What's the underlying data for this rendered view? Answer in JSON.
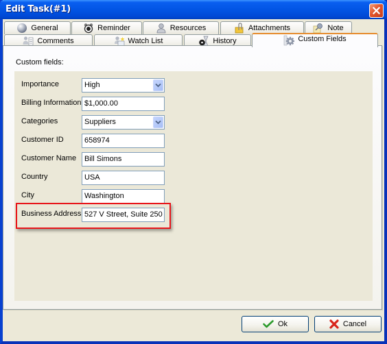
{
  "window": {
    "title": "Edit Task(#1)",
    "close_icon": "close-icon"
  },
  "tabs_row1": [
    {
      "label": "General",
      "icon": "globe-icon"
    },
    {
      "label": "Reminder",
      "icon": "alarm-clock-icon"
    },
    {
      "label": "Resources",
      "icon": "user-icon"
    },
    {
      "label": "Attachments",
      "icon": "paperclip-folder-icon"
    },
    {
      "label": "Note",
      "icon": "pushpin-note-icon"
    }
  ],
  "tabs_row2": [
    {
      "label": "Comments",
      "icon": "comments-icon"
    },
    {
      "label": "Watch List",
      "icon": "watch-list-icon"
    },
    {
      "label": "History",
      "icon": "history-icon"
    },
    {
      "label": "Custom Fields",
      "icon": "gear-icon",
      "active": true
    }
  ],
  "custom_fields": {
    "heading": "Custom fields:",
    "fields": [
      {
        "label": "Importance",
        "value": "High",
        "type": "select"
      },
      {
        "label": "Billing Information",
        "value": "$1,000.00",
        "type": "text"
      },
      {
        "label": "Categories",
        "value": "Suppliers",
        "type": "select"
      },
      {
        "label": "Customer ID",
        "value": "658974",
        "type": "text"
      },
      {
        "label": "Customer Name",
        "value": "Bill Simons",
        "type": "text"
      },
      {
        "label": "Country",
        "value": "USA",
        "type": "text"
      },
      {
        "label": "City",
        "value": "Washington",
        "type": "text"
      },
      {
        "label": "Business Address",
        "value": "527 V Street, Suite 250",
        "type": "text",
        "highlighted": true
      }
    ]
  },
  "buttons": {
    "ok": "Ok",
    "cancel": "Cancel"
  },
  "colors": {
    "titlebar": "#0255e4",
    "active_tab_accent": "#ff9d1c",
    "highlight": "#e8151a",
    "panel": "#ebe8d8"
  }
}
